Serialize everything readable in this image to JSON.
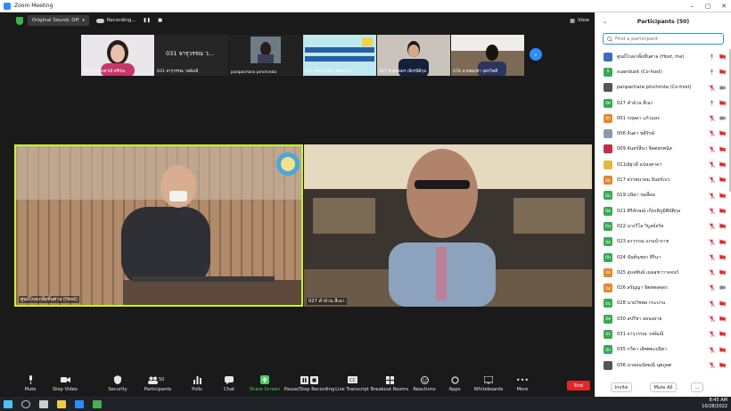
{
  "window": {
    "title": "Zoom Meeting"
  },
  "topbar": {
    "sound_label": "Original Sound: Off",
    "recording_label": "Recording...",
    "view_label": "View"
  },
  "thumbnails": [
    {
      "name": "052 นางกัลยาณี ศรีกัณ"
    },
    {
      "name": "031 จารุวรรณ วงษ์มณี"
    },
    {
      "name": "panpachara pinchinda"
    },
    {
      "name": "017 ธรรพนาคม อินทร์เบว"
    },
    {
      "name": "067 นายนพพร เธียรนิติกุล"
    },
    {
      "name": "078 นายสมเชา บุตรโคคี"
    }
  ],
  "thumbnail_card_text": "031 จารุวรรณ ว...",
  "videos": {
    "left_name": "ศูนย์ไกล่เกลี่ยชั้นศาล (Host)",
    "right_name": "027 คำอ้วน สีเนา"
  },
  "toolbar": {
    "mute": "Mute",
    "stop_video": "Stop Video",
    "security": "Security",
    "participants": "Participants",
    "participants_count": "50",
    "polls": "Polls",
    "chat": "Chat",
    "share_screen": "Share Screen",
    "pause_recording": "Pause/Stop Recording",
    "live_transcript": "Live Transcript",
    "breakout_rooms": "Breakout Rooms",
    "reactions": "Reactions",
    "apps": "Apps",
    "whiteboards": "Whiteboards",
    "more": "More",
    "end": "End"
  },
  "panel": {
    "title": "Participants (50)",
    "search_placeholder": "Find a participant",
    "invite": "Invite",
    "mute_all": "Mute All",
    "more": "..."
  },
  "participants": [
    {
      "initials": "",
      "name": "ศูนย์ไกล่เกลี่ยชั้นศาล (Host, me)",
      "color": "#3b6fb6",
      "muted": false,
      "video": true
    },
    {
      "initials": "S",
      "name": "suandusit (Co-host)",
      "color": "#3aa856",
      "muted": false,
      "video": true
    },
    {
      "initials": "",
      "name": "panpachara pinchinda (Co-host)",
      "color": "#555555",
      "muted": true,
      "video": false
    },
    {
      "initials": "0ค",
      "name": "027 คำอ้วน สีเนา",
      "color": "#3aa856",
      "muted": false,
      "video": true
    },
    {
      "initials": "0ก",
      "name": "001 กฤษดา แก้วแสง",
      "color": "#e08a2c",
      "muted": true,
      "video": false
    },
    {
      "initials": "",
      "name": "006 จินดา พลีรักษ์",
      "color": "#8a9bb0",
      "muted": true,
      "video": true
    },
    {
      "initials": "",
      "name": "009 จันทร์สีนา จิตตพรพนัส",
      "color": "#c0304a",
      "muted": true,
      "video": true
    },
    {
      "initials": "",
      "name": "011ณัฐวดี แปลงคาดา",
      "color": "#e2b93b",
      "muted": true,
      "video": true
    },
    {
      "initials": "0ธ",
      "name": "017 ธรรพนาคม อินทร์เบว",
      "color": "#e08a2c",
      "muted": true,
      "video": true
    },
    {
      "initials": "0บ",
      "name": "019 บนิดา ขอลี้คม",
      "color": "#3aa856",
      "muted": true,
      "video": true
    },
    {
      "initials": "0ส",
      "name": "021 ศิริลักษณ์ เกียรติภูมิพิบัติกุล",
      "color": "#3aa856",
      "muted": true,
      "video": true
    },
    {
      "initials": "0น",
      "name": "022.นางวิไล วิบูลย์จรัส",
      "color": "#3aa856",
      "muted": true,
      "video": true
    },
    {
      "initials": "0อ",
      "name": "023 อรวรรณ แกนนำราช",
      "color": "#3aa856",
      "muted": true,
      "video": true
    },
    {
      "initials": "0น",
      "name": "024 นันท์นุชธร สีรินา",
      "color": "#3aa856",
      "muted": true,
      "video": true
    },
    {
      "initials": "0อ",
      "name": "025 อุบลพันธ์ เมลลุชาวาลจนร์",
      "color": "#e08a2c",
      "muted": true,
      "video": true
    },
    {
      "initials": "0ส",
      "name": "026 สรัญญา จิตตพลคุดร",
      "color": "#e08a2c",
      "muted": true,
      "video": false
    },
    {
      "initials": "0น",
      "name": "028 นายวัชพล กระบาน",
      "color": "#3aa856",
      "muted": true,
      "video": true
    },
    {
      "initials": "0ส",
      "name": "030 สปรีชา สอนสงาย",
      "color": "#3aa856",
      "muted": true,
      "video": true
    },
    {
      "initials": "0จ",
      "name": "031 จารุวรรณ วงษ์มณี",
      "color": "#3aa856",
      "muted": true,
      "video": true
    },
    {
      "initials": "0ก",
      "name": "035 กวีดา เลิศตตะปนิยา",
      "color": "#3aa856",
      "muted": true,
      "video": true
    },
    {
      "initials": "",
      "name": "036 นายอนนัทมณี นุตภูลต",
      "color": "#555555",
      "muted": true,
      "video": true
    }
  ],
  "taskbar": {
    "time": "8:45 AM",
    "date": "10/28/2022"
  }
}
